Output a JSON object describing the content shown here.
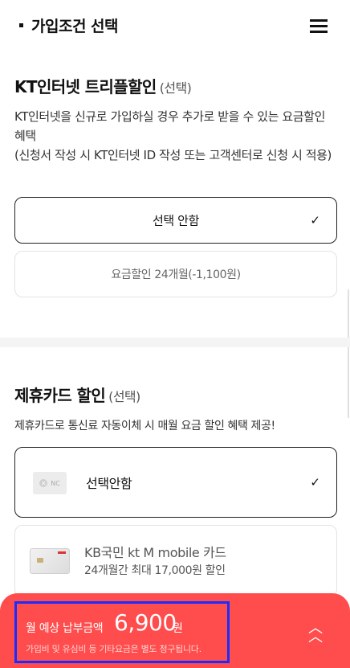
{
  "header": {
    "title": "가입조건 선택",
    "menu_icon": "hamburger-menu-icon"
  },
  "triple_discount": {
    "title": "KT인터넷 트리플할인",
    "optional": "(선택)",
    "description": "KT인터넷을 신규로 가입하실 경우 추가로 받을 수 있는 요금할인 혜택",
    "note": "(신청서 작성 시 KT인터넷 ID 작성 또는 고객센터로 신청 시 적용)",
    "options": [
      {
        "label": "선택 안함",
        "selected": true
      },
      {
        "label": "요금할인 24개월(-1,100원)",
        "selected": false
      }
    ]
  },
  "card_discount": {
    "title": "제휴카드 할인",
    "optional": "(선택)",
    "description": "제휴카드로 통신료 자동이체 시 매월 요금 할인 혜택 제공!",
    "options": [
      {
        "label": "선택안함",
        "icon_text": "NC",
        "selected": true
      },
      {
        "label": "KB국민 kt M mobile 카드",
        "sub": "24개월간 최대 17,000원 할인",
        "selected": false
      }
    ]
  },
  "bottom": {
    "monthly_label": "월 예상 납부금액",
    "amount": "6,900",
    "unit": "원",
    "note": "가입비 및 유심비 등 기타요금은 별도 청구됩니다.",
    "expand_icon": "double-chevron-up-icon",
    "accent_color": "#ff4c4c"
  },
  "check_icon": "check-icon"
}
